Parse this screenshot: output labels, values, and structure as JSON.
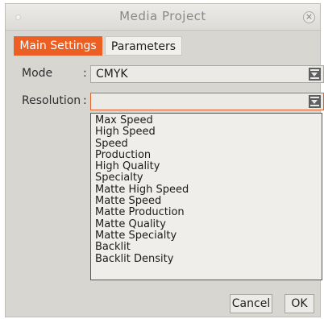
{
  "window": {
    "title": "Media Project",
    "close_glyph": "×"
  },
  "tabs": [
    {
      "label": "Main Settings",
      "active": true
    },
    {
      "label": "Parameters",
      "active": false
    }
  ],
  "fields": {
    "mode": {
      "label": "Mode",
      "colon": ":",
      "value": "CMYK"
    },
    "resolution": {
      "label": "Resolution",
      "colon": ":",
      "value": ""
    }
  },
  "resolution_options": [
    "Max Speed",
    "High Speed",
    "Speed",
    "Production",
    "High Quality",
    "Specialty",
    "Matte High Speed",
    "Matte Speed",
    "Matte Production",
    "Matte Quality",
    "Matte Specialty",
    "Backlit",
    "Backlit Density"
  ],
  "buttons": {
    "cancel": "Cancel",
    "ok": "OK"
  },
  "colors": {
    "accent": "#ec5e22",
    "background": "#d7d6d1"
  }
}
